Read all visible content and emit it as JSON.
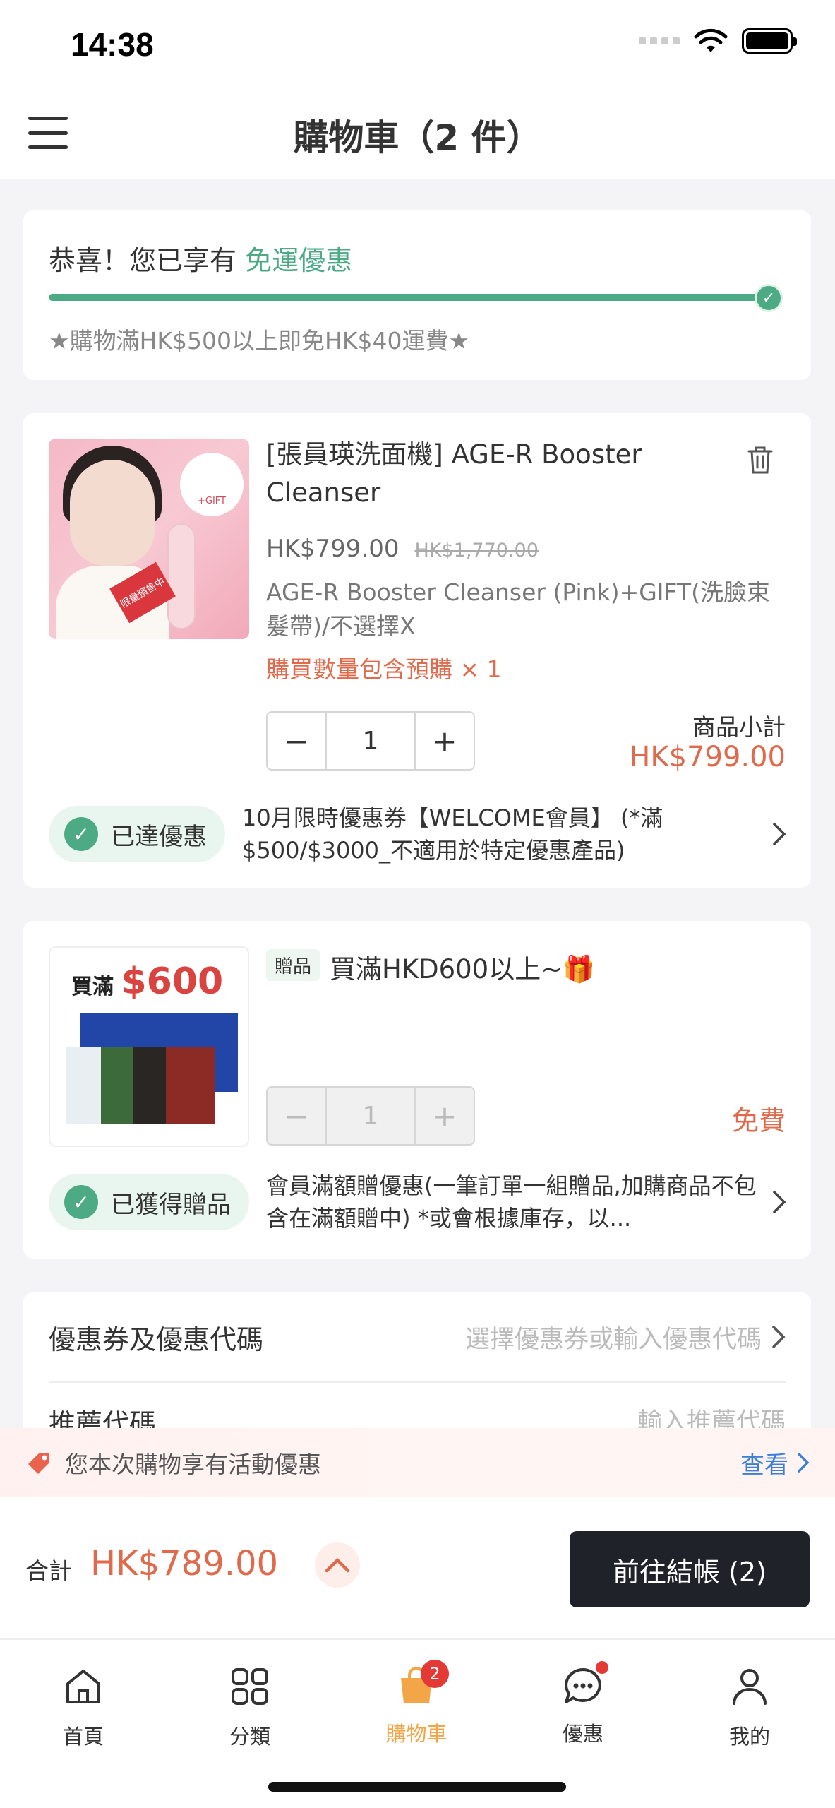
{
  "status_bar": {
    "time": "14:38"
  },
  "header": {
    "title": "購物車（2 件）"
  },
  "shipping": {
    "message": "恭喜！您已享有",
    "highlight": "免運優惠",
    "progress": 1.0,
    "note": "★購物滿HK$500以上即免HK$40運費★"
  },
  "product": {
    "name": "[張員瑛洗面機] AGE-R Booster Cleanser",
    "price": "HK$799.00",
    "original_price": "HK$1,770.00",
    "variant": "AGE-R Booster Cleanser (Pink)+GIFT(洗臉束髮帶)/不選擇X",
    "preorder": "購買數量包含預購 × 1",
    "quantity": "1",
    "subtotal_label": "商品小計",
    "subtotal": "HK$799.00",
    "image_text": {
      "gift": "+GIFT",
      "tag": "限量預售中"
    },
    "promo_badge": "已達優惠",
    "promo_text": "10月限時優惠券【WELCOME會員】 (*滿$500/$3000_不適用於特定優惠產品)"
  },
  "gift": {
    "image_title": "買滿",
    "image_amount": "$600",
    "tag": "贈品",
    "name": "買滿HKD600以上~🎁",
    "quantity": "1",
    "price": "免費",
    "promo_badge": "已獲得贈品",
    "promo_text": "會員滿額贈優惠(一筆訂單一組贈品,加購商品不包含在滿額贈中) *或會根據庫存，以..."
  },
  "coupon": {
    "label": "優惠券及優惠代碼",
    "hint": "選擇優惠券或輸入優惠代碼",
    "referral_label": "推薦代碼",
    "referral_hint": "輸入推薦代碼"
  },
  "banner": {
    "text": "您本次購物享有活動優惠",
    "link": "查看"
  },
  "checkout": {
    "total_label": "合計",
    "total": "HK$789.00",
    "button": "前往結帳 (2)"
  },
  "tabs": [
    {
      "label": "首頁",
      "icon": "home-icon"
    },
    {
      "label": "分類",
      "icon": "grid-icon"
    },
    {
      "label": "購物車",
      "icon": "bag-icon",
      "badge": "2"
    },
    {
      "label": "優惠",
      "icon": "chat-icon"
    },
    {
      "label": "我的",
      "icon": "user-icon"
    }
  ],
  "colors": {
    "accent_green": "#4caa84",
    "price_orange": "#e06a4b",
    "active_tab": "#f3a648",
    "link_blue": "#3d7ed6"
  }
}
